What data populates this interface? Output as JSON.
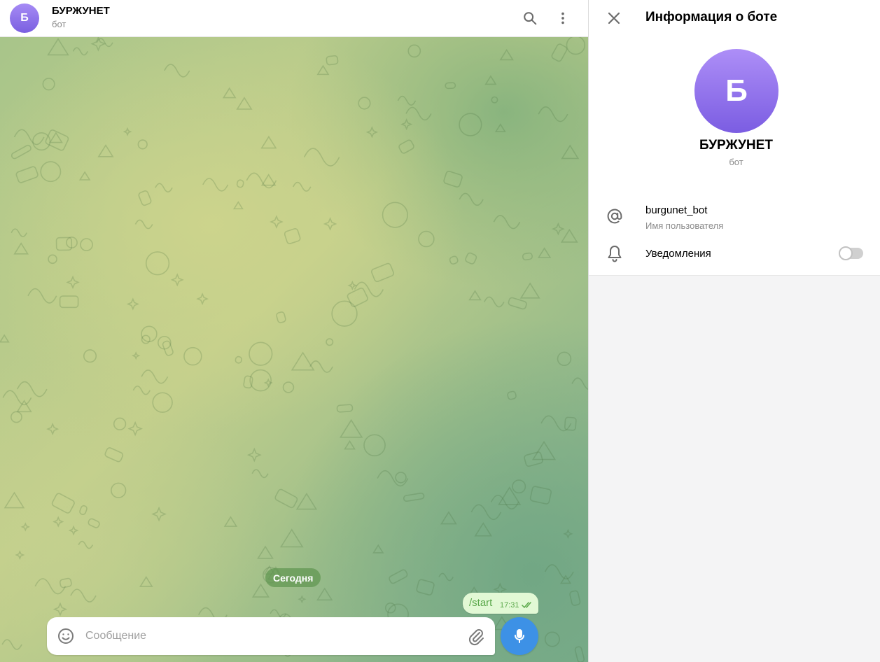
{
  "chat": {
    "header": {
      "avatar_letter": "Б",
      "title": "БУРЖУНЕТ",
      "subtitle": "бот",
      "icons": [
        "search-icon",
        "more-vertical-icon"
      ]
    },
    "date_label": "Сегодня",
    "messages": [
      {
        "text": "/start",
        "time": "17:31",
        "status": "read",
        "outgoing": true
      }
    ],
    "composer": {
      "placeholder": "Сообщение",
      "value": "",
      "icons": [
        "emoji-icon",
        "attach-icon",
        "mic-icon"
      ]
    }
  },
  "panel": {
    "title": "Информация о боте",
    "avatar_letter": "Б",
    "name": "БУРЖУНЕТ",
    "subtitle": "бот",
    "username": "burgunet_bot",
    "username_caption": "Имя пользователя",
    "notifications_label": "Уведомления",
    "notifications_enabled": false,
    "icons": [
      "close-icon",
      "at-icon",
      "bell-icon"
    ]
  },
  "colors": {
    "avatar": "#8a6eea",
    "accent": "#3d91e6",
    "outgoing_bubble": "#e2f9d5",
    "date_pill": "#6d9b5a"
  }
}
